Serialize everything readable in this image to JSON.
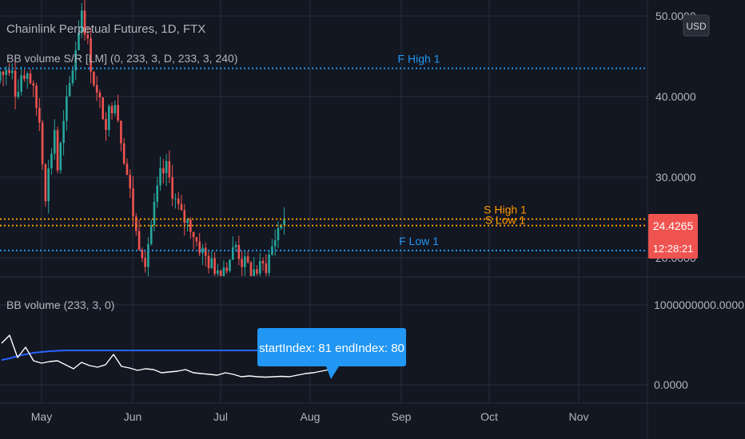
{
  "header": {
    "symbol_title": "Chainlink Perpetual Futures, 1D, FTX",
    "indicator_title": "BB volume S/R [LM] (0, 233, 3, D, 233, 3, 240)",
    "currency_button": "USD"
  },
  "lower_pane": {
    "title": "BB volume (233, 3, 0)",
    "tooltip": "startIndex: 81 endIndex: 80"
  },
  "price_labels": {
    "last_price": "24.4265",
    "countdown": "12:28:21"
  },
  "colors": {
    "background": "#131722",
    "grid": "#2a2e39",
    "candle_up": "#26a69a",
    "candle_down": "#ef5350",
    "level_f": "#2196f3",
    "level_s": "#ff9800",
    "volume_line": "#ffffff",
    "band_line": "#2962ff",
    "tooltip_bg": "#2196f3"
  },
  "chart_data": [
    {
      "type": "line",
      "name": "price",
      "y_axis": {
        "ticks": [
          "50.0000",
          "40.0000",
          "30.0000",
          "20.0000"
        ],
        "ylim": [
          18.5,
          51.5
        ]
      },
      "x_axis": {
        "ticks": [
          "May",
          "Jun",
          "Jul",
          "Aug",
          "Sep",
          "Oct",
          "Nov"
        ]
      },
      "x": [
        0,
        3,
        5,
        8,
        9,
        12,
        15,
        17,
        20,
        22,
        25,
        28,
        30,
        33,
        35,
        38,
        40,
        43,
        45,
        48,
        50,
        53,
        55,
        58,
        60,
        63,
        65,
        68,
        70,
        73,
        75,
        78,
        80,
        82,
        84
      ],
      "y": [
        42,
        37,
        28,
        36,
        31,
        39,
        46,
        51,
        44,
        40,
        37,
        40,
        35,
        28,
        23,
        20,
        24,
        30,
        31,
        27,
        25,
        24,
        22,
        20,
        19,
        18.5,
        19.3,
        21.5,
        19.5,
        18.3,
        18.4,
        19,
        21.3,
        23.6,
        25.1
      ],
      "levels": [
        {
          "name": "F High 1",
          "value": 43.5,
          "color": "#2196f3"
        },
        {
          "name": "S High 1",
          "value": 24.8,
          "color": "#ff9800"
        },
        {
          "name": "S Low 1",
          "value": 24.0,
          "color": "#ff9800"
        },
        {
          "name": "F Low 1",
          "value": 20.9,
          "color": "#2196f3"
        }
      ]
    },
    {
      "type": "line",
      "name": "BB volume",
      "y_axis": {
        "ticks": [
          "1000000000.0000",
          "0.0000"
        ],
        "ylim": [
          -50000000,
          1050000000
        ]
      },
      "x": [
        0,
        2,
        4,
        6,
        8,
        10,
        12,
        14,
        16,
        18,
        20,
        22,
        24,
        26,
        28,
        30,
        32,
        34,
        36,
        38,
        40,
        42,
        44,
        46,
        48,
        50,
        52,
        54,
        56,
        58,
        60,
        62,
        64,
        66,
        68,
        70,
        72,
        74,
        76,
        78,
        80,
        82
      ],
      "series": [
        {
          "values": [
            520,
            620,
            340,
            470,
            300,
            270,
            290,
            300,
            250,
            200,
            280,
            240,
            220,
            250,
            380,
            230,
            210,
            180,
            200,
            190,
            150,
            160,
            170,
            190,
            150,
            140,
            130,
            120,
            150,
            130,
            100,
            110,
            100,
            95,
            100,
            105,
            100,
            120,
            140,
            150,
            170,
            190
          ]
        },
        {
          "values": [
            310,
            330,
            360,
            380,
            400,
            410,
            420,
            425,
            430,
            430,
            430,
            430,
            430,
            430,
            430,
            430,
            430,
            430,
            430,
            430,
            430,
            430,
            430,
            430,
            430,
            430,
            430,
            430,
            430,
            430,
            430,
            430,
            430,
            430,
            430,
            430,
            430,
            430,
            430,
            430,
            430,
            430
          ]
        }
      ]
    }
  ]
}
